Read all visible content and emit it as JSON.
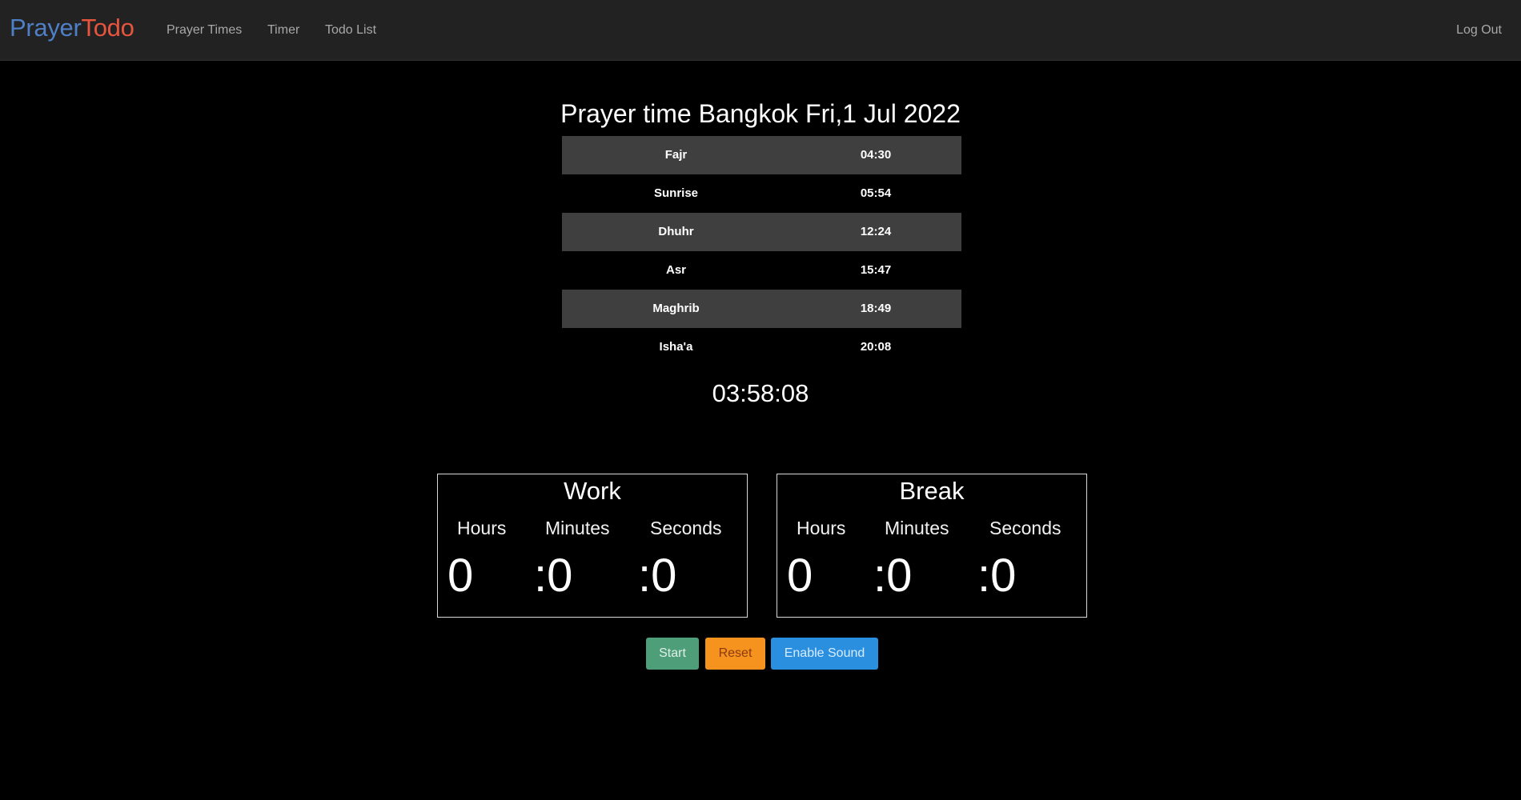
{
  "navbar": {
    "brand_part1": "Prayer",
    "brand_part2": "Todo",
    "links": [
      {
        "label": "Prayer Times"
      },
      {
        "label": "Timer"
      },
      {
        "label": "Todo List"
      }
    ],
    "logout_label": "Log Out"
  },
  "prayer": {
    "title": "Prayer time Bangkok Fri,1 Jul 2022",
    "rows": [
      {
        "name": "Fajr",
        "time": "04:30"
      },
      {
        "name": "Sunrise",
        "time": "05:54"
      },
      {
        "name": "Dhuhr",
        "time": "12:24"
      },
      {
        "name": "Asr",
        "time": "15:47"
      },
      {
        "name": "Maghrib",
        "time": "18:49"
      },
      {
        "name": "Isha'a",
        "time": "20:08"
      }
    ],
    "countdown": "03:58:08"
  },
  "timers": {
    "work": {
      "title": "Work",
      "hours_label": "Hours",
      "minutes_label": "Minutes",
      "seconds_label": "Seconds",
      "hours_value": "0",
      "minutes_value": ":0",
      "seconds_value": ":0"
    },
    "break": {
      "title": "Break",
      "hours_label": "Hours",
      "minutes_label": "Minutes",
      "seconds_label": "Seconds",
      "hours_value": "0",
      "minutes_value": ":0",
      "seconds_value": ":0"
    }
  },
  "buttons": {
    "start_label": "Start",
    "reset_label": "Reset",
    "sound_label": "Enable Sound"
  },
  "colors": {
    "background": "#000000",
    "navbar": "#222222",
    "brand_prayer": "#4f7fc6",
    "brand_todo": "#e8553e",
    "row_shade": "#3f3f3f",
    "start": "#4f9e7a",
    "reset": "#f5931e",
    "sound": "#2b8fe0"
  }
}
